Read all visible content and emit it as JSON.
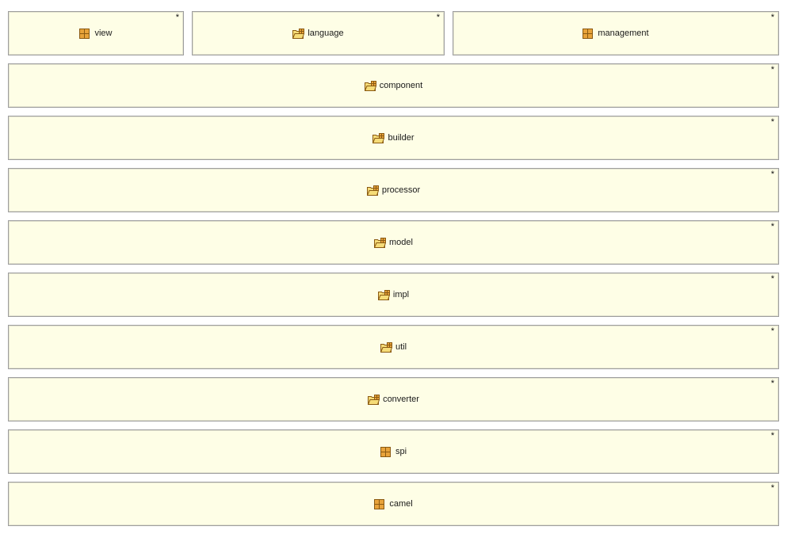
{
  "packages": [
    {
      "name": "view",
      "icon": "package-icon",
      "marker": "*"
    },
    {
      "name": "language",
      "icon": "package-folder-icon",
      "marker": "*"
    },
    {
      "name": "management",
      "icon": "package-icon",
      "marker": "*"
    },
    {
      "name": "component",
      "icon": "package-folder-icon",
      "marker": "*"
    },
    {
      "name": "builder",
      "icon": "package-folder-icon",
      "marker": "*"
    },
    {
      "name": "processor",
      "icon": "package-folder-icon",
      "marker": "*"
    },
    {
      "name": "model",
      "icon": "package-folder-icon",
      "marker": "*"
    },
    {
      "name": "impl",
      "icon": "package-folder-icon",
      "marker": "*"
    },
    {
      "name": "util",
      "icon": "package-folder-icon",
      "marker": "*"
    },
    {
      "name": "converter",
      "icon": "package-folder-icon",
      "marker": "*"
    },
    {
      "name": "spi",
      "icon": "package-icon",
      "marker": "*"
    },
    {
      "name": "camel",
      "icon": "package-icon",
      "marker": "*"
    }
  ],
  "colors": {
    "box_fill": "#fefee6",
    "box_border": "#9e9e9e",
    "icon_fill": "#e8a33a",
    "icon_stroke": "#8a5a12",
    "folder_fill": "#f6dc78"
  }
}
